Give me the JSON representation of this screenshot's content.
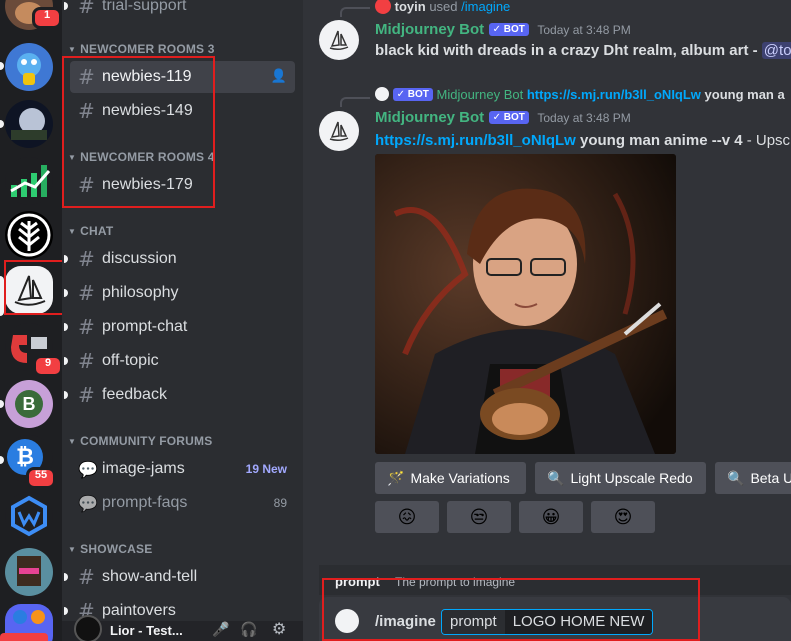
{
  "servers": {
    "badges": [
      "1",
      "9",
      "55"
    ]
  },
  "sidebar": {
    "top_channel": "trial-support",
    "categories": {
      "newcomer3": "NEWCOMER ROOMS 3",
      "newcomer4": "NEWCOMER ROOMS 4",
      "chat": "CHAT",
      "forums": "COMMUNITY FORUMS",
      "showcase": "SHOWCASE"
    },
    "channels": {
      "newbies119": "newbies-119",
      "newbies149": "newbies-149",
      "newbies179": "newbies-179",
      "discussion": "discussion",
      "philosophy": "philosophy",
      "prompt_chat": "prompt-chat",
      "off_topic": "off-topic",
      "feedback": "feedback",
      "image_jams": "image-jams",
      "image_jams_badge": "19 New",
      "prompt_faqs": "prompt-faqs",
      "prompt_faqs_count": "89",
      "show_and_tell": "show-and-tell",
      "paintovers": "paintovers"
    },
    "user": "Lior - Test..."
  },
  "chat": {
    "interaction1": {
      "user": "toyin",
      "used": "used",
      "command": "/imagine"
    },
    "message1": {
      "author": "Midjourney Bot",
      "bot_label": "✓ BOT",
      "timestamp": "Today at 3:48 PM",
      "text": "black kid with dreads in a crazy Dht realm, album art - ",
      "mention": "@to"
    },
    "reply": {
      "bot_label": "✓ BOT",
      "author": "Midjourney Bot",
      "link": "https://s.mj.run/b3ll_oNIqLw",
      "text": " young man a"
    },
    "message2": {
      "author": "Midjourney Bot",
      "bot_label": "✓ BOT",
      "timestamp": "Today at 3:48 PM",
      "link": "https://s.mj.run/b3ll_oNIqLw",
      "text": " young man anime --v 4",
      "suffix": " - Upsc"
    },
    "buttons": {
      "variations": "Make Variations",
      "light_upscale": "Light Upscale Redo",
      "beta": "Beta U"
    },
    "reactions": [
      "😖",
      "😒",
      "😀",
      "😍"
    ]
  },
  "composer": {
    "hint_param": "prompt",
    "hint_desc": "The prompt to imagine",
    "command": "/imagine",
    "param_label": "prompt",
    "value": "LOGO HOME NEW"
  },
  "colors": {
    "accent": "#5865f2",
    "highlight": "#e01e1e",
    "bot_name": "#43b581",
    "link": "#00a8fc"
  }
}
